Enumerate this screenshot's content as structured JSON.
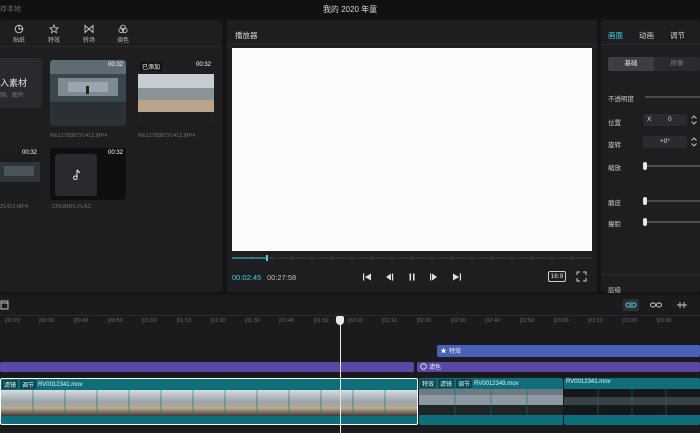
{
  "titlebar": {
    "left": "存本地",
    "title": "我的 2020 年童"
  },
  "media_toolbar": [
    {
      "label": "贴纸",
      "icon": "sticker-icon"
    },
    {
      "label": "特效",
      "icon": "effects-icon"
    },
    {
      "label": "转场",
      "icon": "transition-icon"
    },
    {
      "label": "调色",
      "icon": "color-icon"
    }
  ],
  "media": {
    "import_label": "入素材",
    "import_hint": "频、图片",
    "items": [
      {
        "duration": "00:32",
        "name": "RE127838721412.MP4",
        "added": ""
      },
      {
        "duration": "00:32",
        "name": "RE127838721412.MP4",
        "added": "已添加"
      },
      {
        "duration": "00:32",
        "name": "21412.MP4",
        "added": ""
      },
      {
        "duration": "00:32",
        "name": "CRUMBS.FLAC",
        "added": ""
      }
    ]
  },
  "player": {
    "title": "播放器",
    "current_time": "00:02:45",
    "total_time": "00:27:58",
    "ratio": "16:9"
  },
  "props": {
    "tabs": [
      "画面",
      "动画",
      "调节"
    ],
    "segments": [
      "基础",
      "抠像"
    ],
    "opacity_label": "不透明度",
    "position_label": "位置",
    "position_x_label": "X",
    "position_x": "0",
    "rotation_label": "旋转",
    "rotation_value": "+0°",
    "scale_label": "缩放",
    "smooth_label": "磨皮",
    "slim_label": "瘦脸",
    "layer_label": "层级"
  },
  "timeline": {
    "ticks": [
      "00:20",
      "00:30",
      "00:40",
      "00:50",
      "01:00",
      "01:10",
      "01:20",
      "01:30",
      "01:40",
      "01:50",
      "02:00",
      "02:10",
      "02:20",
      "02:30",
      "02:40",
      "02:50",
      "03:00",
      "03:10",
      "03:20",
      "03:30"
    ],
    "effect_clip": "特效",
    "filter_clip": "滤色",
    "clip1": {
      "tags": [
        "滤镜",
        "调节"
      ],
      "name": "RV0012341.mov"
    },
    "clip2": {
      "tags": [
        "特效",
        "滤镜",
        "调节"
      ],
      "name": "RV0012349.mov"
    },
    "clip3": {
      "name": "RV0012341.mov"
    }
  },
  "colors": {
    "accent": "#3fd2e8",
    "video_track": "#0e6f7a",
    "effect_track": "#4a5fb8",
    "filter_track": "#5a48a6"
  }
}
